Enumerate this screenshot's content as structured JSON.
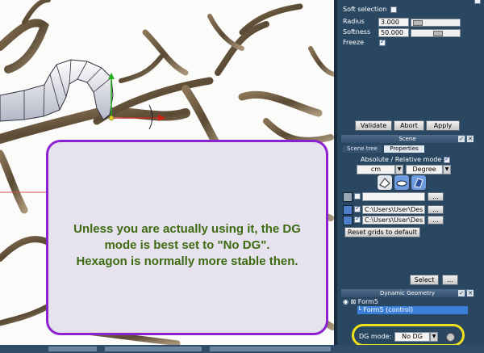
{
  "annotation": {
    "text": "Unless you are actually using it, the DG\nmode is best set to \"No DG\".\nHexagon is normally more stable then."
  },
  "softselection": {
    "title": "Soft selection",
    "radius_label": "Radius",
    "radius_value": "3.000",
    "softness_label": "Softness",
    "softness_value": "50.000",
    "freeze_label": "Freeze",
    "freeze_checked": true,
    "validate": "Validate",
    "abort": "Abort",
    "apply": "Apply"
  },
  "scene": {
    "title": "Scene",
    "tabs": [
      "Scene tree",
      "Properties"
    ],
    "abs_rel_label": "Absolute / Relative mode",
    "unit": "cm",
    "angle": "Degree",
    "paths": [
      {
        "checked": false,
        "value": ""
      },
      {
        "checked": true,
        "value": "C:\\Users\\User\\Des"
      },
      {
        "checked": true,
        "value": "C:\\Users\\User\\Des"
      }
    ],
    "browse": "...",
    "reset": "Reset grids to default",
    "select": "Select"
  },
  "dg": {
    "title": "Dynamic Geometry",
    "tree": [
      "Form5",
      "Form5 (control)"
    ],
    "mode_label": "DG mode:",
    "mode_value": "No DG"
  },
  "colors": {
    "panel": "#2a4762",
    "highlight": "#f1e11a",
    "callout_border": "#8a22d0",
    "callout_text": "#3e6b12"
  }
}
